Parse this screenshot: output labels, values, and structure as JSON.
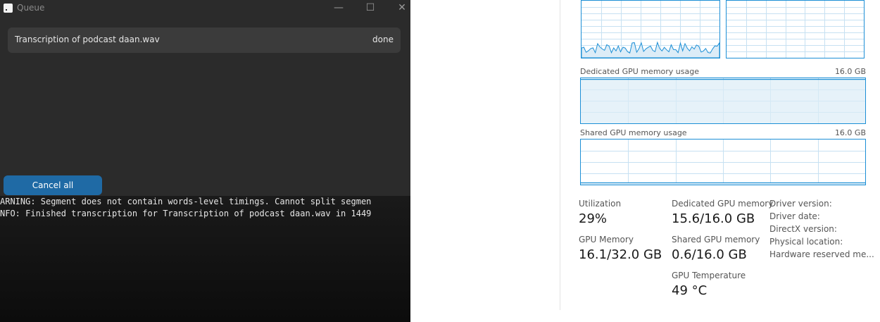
{
  "queue_window": {
    "title": "Queue",
    "controls": {
      "minimize": "—",
      "maximize": "☐",
      "close": "✕"
    },
    "items": [
      {
        "name": "Transcription of podcast daan.wav",
        "status": "done"
      }
    ],
    "cancel_all_label": "Cancel all"
  },
  "console": {
    "lines": [
      "ARNING: Segment does not contain words-level timings. Cannot split segmen",
      "NFO: Finished transcription for Transcription of podcast daan.wav in 1449"
    ]
  },
  "gpu_panel": {
    "dedicated_graph": {
      "label": "Dedicated GPU memory usage",
      "max": "16.0 GB",
      "fill_fraction": 0.975
    },
    "shared_graph": {
      "label": "Shared GPU memory usage",
      "max": "16.0 GB",
      "fill_fraction": 0.04
    },
    "stats": {
      "utilization": {
        "label": "Utilization",
        "value": "29%"
      },
      "dedicated_memory": {
        "label": "Dedicated GPU memory",
        "value": "15.6/16.0 GB"
      },
      "gpu_memory": {
        "label": "GPU Memory",
        "value": "16.1/32.0 GB"
      },
      "shared_memory": {
        "label": "Shared GPU memory",
        "value": "0.6/16.0 GB"
      },
      "temperature": {
        "label": "GPU Temperature",
        "value": "49 °C"
      }
    },
    "info_labels": {
      "driver_version": "Driver version:",
      "driver_date": "Driver date:",
      "directx_version": "DirectX version:",
      "physical_location": "Physical location:",
      "hardware_reserved": "Hardware reserved me..."
    },
    "colors": {
      "accent": "#1c8fd6",
      "fill": "#dcecf7"
    }
  }
}
